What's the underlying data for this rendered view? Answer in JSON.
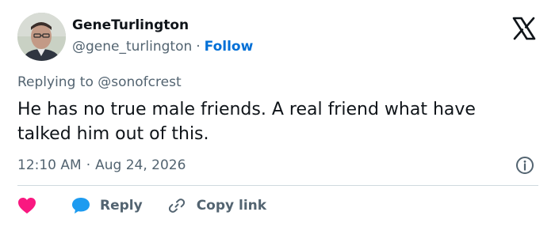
{
  "user": {
    "display_name": "GeneTurlington",
    "handle": "@gene_turlington",
    "separator": "·",
    "follow_label": "Follow"
  },
  "tweet": {
    "replying_prefix": "Replying to",
    "replying_to": "@sonofcrest",
    "text": "He has no true male friends. A real friend what have talked him out of this.",
    "time": "12:10 AM",
    "date_separator": "·",
    "date": "Aug 24, 2026"
  },
  "actions": {
    "reply_label": "Reply",
    "copy_link_label": "Copy link"
  },
  "colors": {
    "follow": "#006fd6",
    "like_heart": "#f91880",
    "reply_bubble": "#1d9bf0",
    "muted_text": "#536471"
  },
  "icons": {
    "logo": "x-logo-icon",
    "info": "info-icon",
    "like": "heart-icon",
    "reply": "speech-bubble-icon",
    "copy": "link-icon"
  }
}
